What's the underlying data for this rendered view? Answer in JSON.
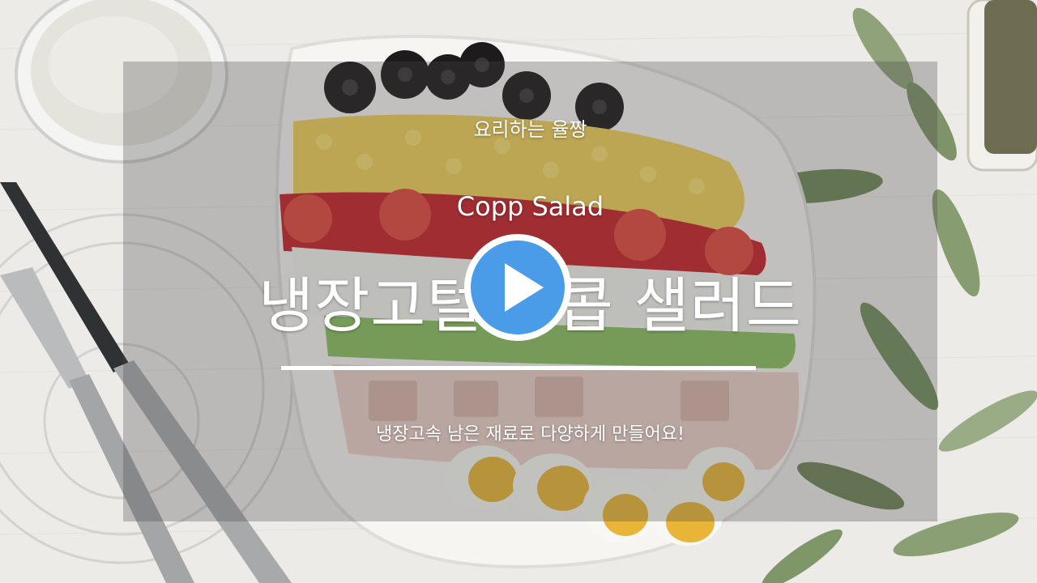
{
  "video": {
    "channel_name": "요리하는 율짱",
    "subtitle": "Copp Salad",
    "title": "냉장고털이 콥 샐러드",
    "caption": "냉장고속 남은 재료로 다양하게 만들어요!"
  },
  "controls": {
    "play_icon": "play-icon",
    "play_color": "#4a9be8"
  }
}
